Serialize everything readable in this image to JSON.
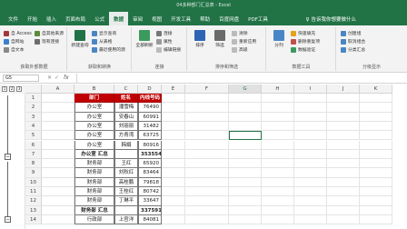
{
  "window": {
    "title": "04多种部门汇总表 - Excel"
  },
  "tabs": [
    "文件",
    "开始",
    "插入",
    "页面布局",
    "公式",
    "数据",
    "审阅",
    "视图",
    "开发工具",
    "帮助",
    "百度网盘",
    "PDF工具"
  ],
  "active_tab": "数据",
  "tell_me": "告诉我你想要做什么",
  "ribbon": {
    "get_external": {
      "label": "获取外部数据",
      "items": [
        "自 Access",
        "自网站",
        "自文本",
        "自其他来源",
        "现有连接"
      ]
    },
    "transform": {
      "label": "获取和转换",
      "new_query": "新建查询",
      "items": [
        "显示查询",
        "从表格",
        "最近使用的源"
      ]
    },
    "connections": {
      "label": "连接",
      "refresh": "全部刷新",
      "items": [
        "连接",
        "属性",
        "编辑链接"
      ]
    },
    "sort_filter": {
      "label": "排序和筛选",
      "sort": "排序",
      "filter": "筛选",
      "items": [
        "清除",
        "重新应用",
        "高级"
      ]
    },
    "tools": {
      "label": "数据工具",
      "split": "分列",
      "items": [
        "快速填充",
        "删除重复项",
        "数据验证"
      ]
    },
    "outline": {
      "items": [
        "创建组",
        "取消组合",
        "分类汇总"
      ],
      "label": "分级显示"
    }
  },
  "formula_bar": {
    "name_box": "G5",
    "cancel": "✕",
    "enter": "✓",
    "fx": "fx",
    "value": ""
  },
  "outline_levels": [
    "1",
    "2",
    "3"
  ],
  "columns": [
    "A",
    "B",
    "C",
    "D",
    "E",
    "F",
    "G",
    "H",
    "I",
    "J",
    "K"
  ],
  "selected_column": "G",
  "rows": [
    {
      "num": "1",
      "cells": [
        "部门",
        "姓名",
        "内线号码"
      ],
      "type": "header"
    },
    {
      "num": "2",
      "cells": [
        "办公室",
        "潘雪梅",
        "76490"
      ],
      "type": "data"
    },
    {
      "num": "3",
      "cells": [
        "办公室",
        "安春山",
        "60991"
      ],
      "type": "data"
    },
    {
      "num": "4",
      "cells": [
        "办公室",
        "刘丽丽",
        "31482"
      ],
      "type": "data"
    },
    {
      "num": "5",
      "cells": [
        "办公室",
        "方青湾",
        "63725"
      ],
      "type": "data"
    },
    {
      "num": "6",
      "cells": [
        "办公室",
        "韩娟",
        "80916"
      ],
      "type": "data"
    },
    {
      "num": "7",
      "cells": [
        "办公室 汇总",
        "",
        "353554"
      ],
      "type": "subtotal"
    },
    {
      "num": "8",
      "cells": [
        "财务部",
        "王红",
        "65920"
      ],
      "type": "data"
    },
    {
      "num": "9",
      "cells": [
        "财务部",
        "刘秋红",
        "83464"
      ],
      "type": "data"
    },
    {
      "num": "10",
      "cells": [
        "财务部",
        "高桂鹏",
        "79818"
      ],
      "type": "data"
    },
    {
      "num": "11",
      "cells": [
        "财务部",
        "王桂红",
        "80742"
      ],
      "type": "data"
    },
    {
      "num": "12",
      "cells": [
        "财务部",
        "丁琳平",
        "33647"
      ],
      "type": "data"
    },
    {
      "num": "13",
      "cells": [
        "财务部 汇总",
        "",
        "337591"
      ],
      "type": "subtotal"
    },
    {
      "num": "14",
      "cells": [
        "行政部",
        "上官洋",
        "84081"
      ],
      "type": "data"
    }
  ],
  "colors": {
    "excel_green": "#217346",
    "header_red": "#c00000"
  }
}
